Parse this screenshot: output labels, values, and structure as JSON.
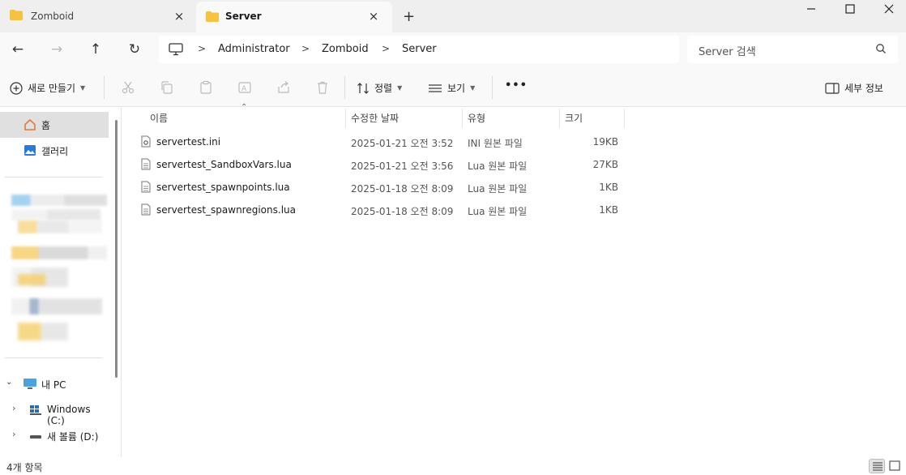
{
  "tabs": [
    {
      "label": "Zomboid",
      "active": false
    },
    {
      "label": "Server",
      "active": true
    }
  ],
  "address": {
    "crumbs": [
      "Administrator",
      "Zomboid",
      "Server"
    ],
    "search_placeholder": "Server 검색"
  },
  "commands": {
    "new_label": "새로 만들기",
    "sort_label": "정렬",
    "view_label": "보기",
    "more_label": "•••",
    "details_label": "세부 정보"
  },
  "sidebar": {
    "home_label": "홈",
    "gallery_label": "갤러리",
    "pc_label": "내 PC",
    "drive_c_label": "Windows (C:)",
    "drive_d_label": "새 볼륨 (D:)"
  },
  "columns": {
    "name": "이름",
    "date": "수정한 날짜",
    "type": "유형",
    "size": "크기"
  },
  "files": [
    {
      "name": "servertest.ini",
      "date": "2025-01-21 오전 3:52",
      "type": "INI 원본 파일",
      "size": "19KB",
      "icon": "settings-file-icon"
    },
    {
      "name": "servertest_SandboxVars.lua",
      "date": "2025-01-21 오전 3:56",
      "type": "Lua 원본 파일",
      "size": "27KB",
      "icon": "document-icon"
    },
    {
      "name": "servertest_spawnpoints.lua",
      "date": "2025-01-18 오전 8:09",
      "type": "Lua 원본 파일",
      "size": "1KB",
      "icon": "document-icon"
    },
    {
      "name": "servertest_spawnregions.lua",
      "date": "2025-01-18 오전 8:09",
      "type": "Lua 원본 파일",
      "size": "1KB",
      "icon": "document-icon"
    }
  ],
  "status": {
    "item_count": "4개 항목"
  },
  "colors": {
    "folder": "#f5c242",
    "accent": "#0067c0",
    "selection": "#e0e0e0"
  }
}
